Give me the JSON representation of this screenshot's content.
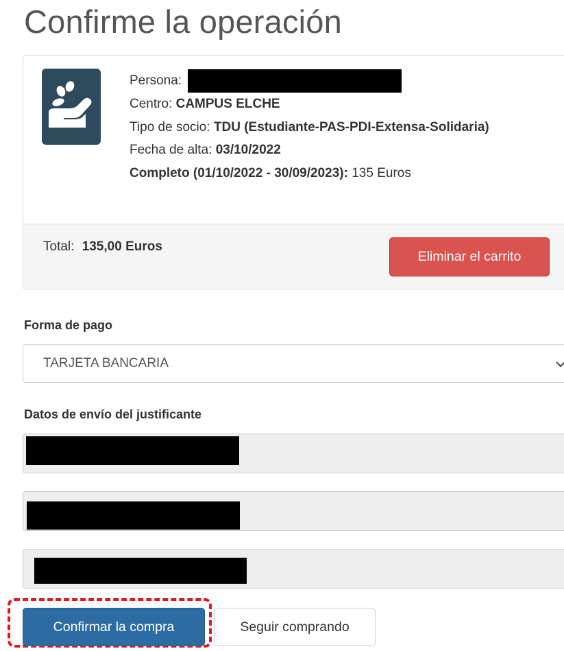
{
  "page": {
    "title": "Confirme la operación"
  },
  "item": {
    "persona_label": "Persona:",
    "centro_label": "Centro:",
    "centro_value": "CAMPUS ELCHE",
    "tipo_label": "Tipo de socio:",
    "tipo_value": "TDU (Estudiante-PAS-PDI-Extensa-Solidaria)",
    "fecha_label": "Fecha de alta:",
    "fecha_value": "03/10/2022",
    "periodo_label": "Completo (01/10/2022 - 30/09/2023):",
    "periodo_value": "135 Euros",
    "icon": "coins-in-hand-icon"
  },
  "cart": {
    "total_label": "Total:",
    "total_value": "135,00 Euros",
    "remove_button": "Eliminar el carrito"
  },
  "payment": {
    "label": "Forma de pago",
    "selected": "TARJETA BANCARIA"
  },
  "shipping": {
    "label": "Datos de envío del justificante"
  },
  "actions": {
    "confirm_button": "Confirmar la compra",
    "continue_button": "Seguir comprando"
  },
  "colors": {
    "danger": "#d9534f",
    "primary": "#2d6ca2",
    "icon_bg": "#2e4b5e",
    "highlight": "#e8141c"
  }
}
